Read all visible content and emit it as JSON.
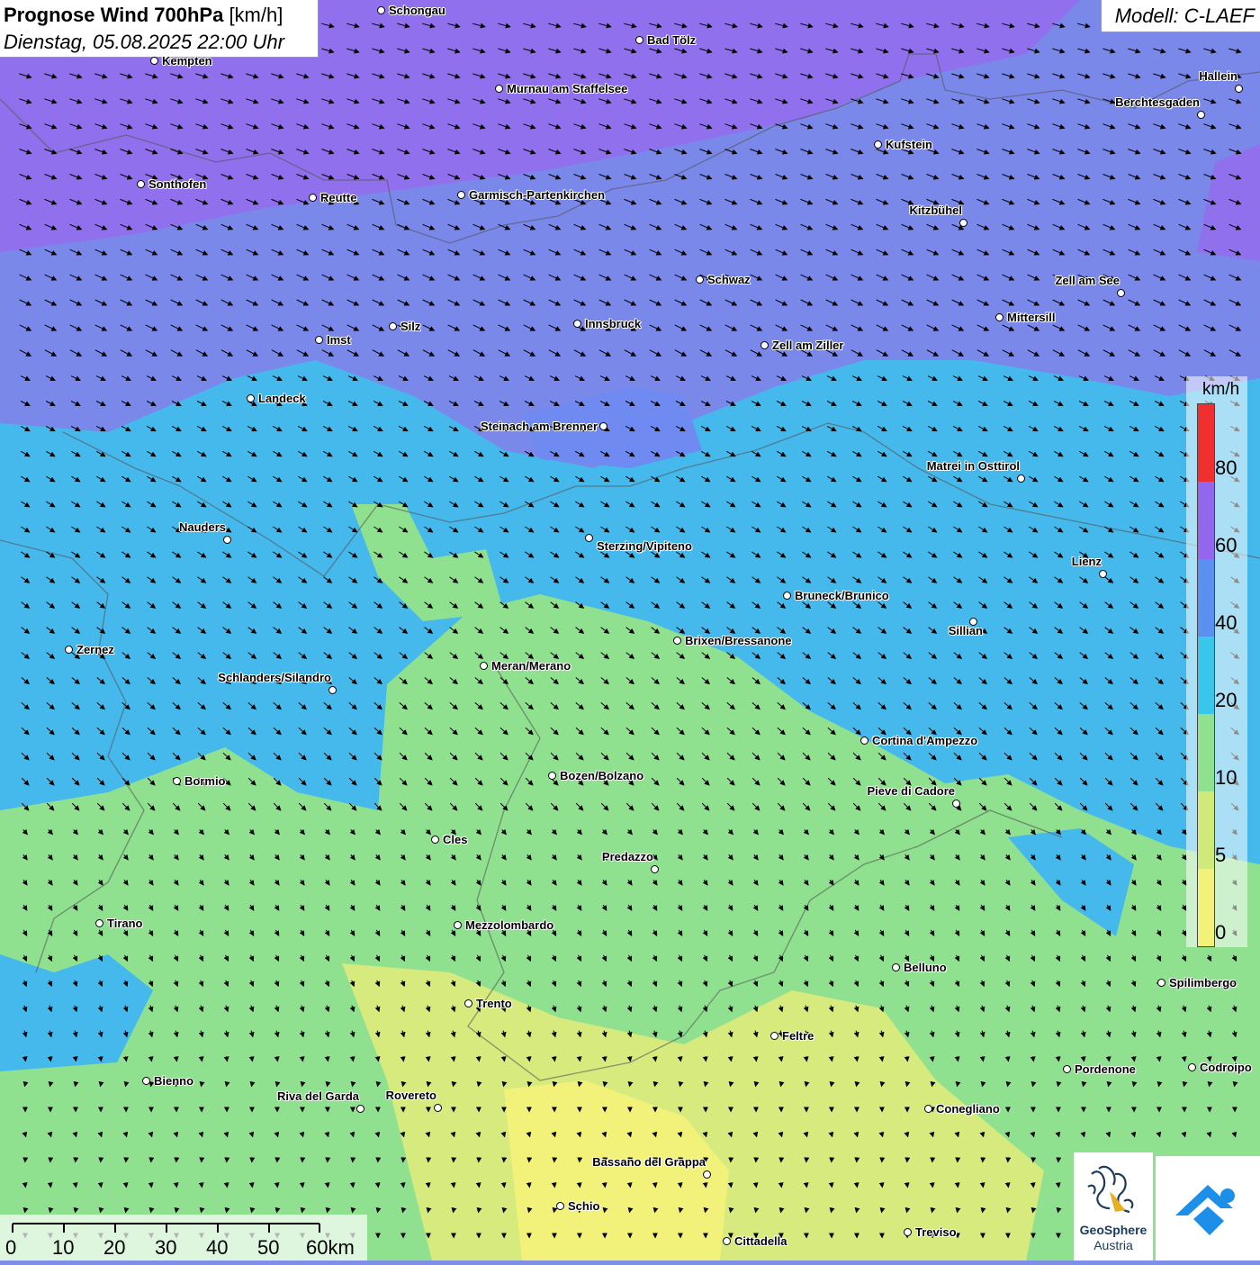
{
  "header": {
    "title_bold": "Prognose Wind 700hPa",
    "title_unit": "[km/h]",
    "subtitle": "Dienstag, 05.08.2025 22:00 Uhr",
    "model": "Modell: C-LAEF"
  },
  "legend": {
    "unit": "km/h",
    "labels": [
      "80",
      "60",
      "40",
      "20",
      "10",
      "5",
      "0"
    ],
    "colors": [
      "#f2f27a",
      "#cfe97a",
      "#8fe08f",
      "#38c6ea",
      "#5a90ef",
      "#9366ee",
      "#f03030"
    ]
  },
  "scalebar": {
    "labels": [
      "0",
      "10",
      "20",
      "30",
      "40",
      "50",
      "60km"
    ]
  },
  "logo": {
    "line1": "GeoSphere",
    "line2": "Austria",
    "icon": "geosphere-logo-icon"
  },
  "app_icon": "app-logo-icon",
  "cities": [
    {
      "name": "Schongau"
    },
    {
      "name": "Bad Tölz"
    },
    {
      "name": "Kempten"
    },
    {
      "name": "Murnau am Staffelsee"
    },
    {
      "name": "Hallein"
    },
    {
      "name": "Berchtesgaden"
    },
    {
      "name": "Kufstein"
    },
    {
      "name": "Sonthofen"
    },
    {
      "name": "Reutte"
    },
    {
      "name": "Garmisch-Partenkirchen"
    },
    {
      "name": "Kitzbühel"
    },
    {
      "name": "Schwaz"
    },
    {
      "name": "Zell am See"
    },
    {
      "name": "Silz"
    },
    {
      "name": "Innsbruck"
    },
    {
      "name": "Mittersill"
    },
    {
      "name": "Imst"
    },
    {
      "name": "Zell am Ziller"
    },
    {
      "name": "Landeck"
    },
    {
      "name": "Steinach am Brenner"
    },
    {
      "name": "Matrei in Osttirol"
    },
    {
      "name": "Nauders"
    },
    {
      "name": "Sterzing/Vipiteno"
    },
    {
      "name": "Lienz"
    },
    {
      "name": "Bruneck/Brunico"
    },
    {
      "name": "Sillian"
    },
    {
      "name": "Zernez"
    },
    {
      "name": "Brixen/Bressanone"
    },
    {
      "name": "Meran/Merano"
    },
    {
      "name": "Schlanders/Silandro"
    },
    {
      "name": "Cortina d'Ampezzo"
    },
    {
      "name": "Bozen/Bolzano"
    },
    {
      "name": "Bormio"
    },
    {
      "name": "Pieve di Cadore"
    },
    {
      "name": "Cles"
    },
    {
      "name": "Predazzo"
    },
    {
      "name": "Tirano"
    },
    {
      "name": "Mezzolombardo"
    },
    {
      "name": "Belluno"
    },
    {
      "name": "Spilimbergo"
    },
    {
      "name": "Trento"
    },
    {
      "name": "Feltre"
    },
    {
      "name": "Pordenone"
    },
    {
      "name": "Codroipo"
    },
    {
      "name": "Bienno"
    },
    {
      "name": "Riva del Garda"
    },
    {
      "name": "Rovereto"
    },
    {
      "name": "Conegliano"
    },
    {
      "name": "Bassano del Grappa"
    },
    {
      "name": "Schio"
    },
    {
      "name": "Treviso"
    },
    {
      "name": "Cittadella"
    }
  ]
}
